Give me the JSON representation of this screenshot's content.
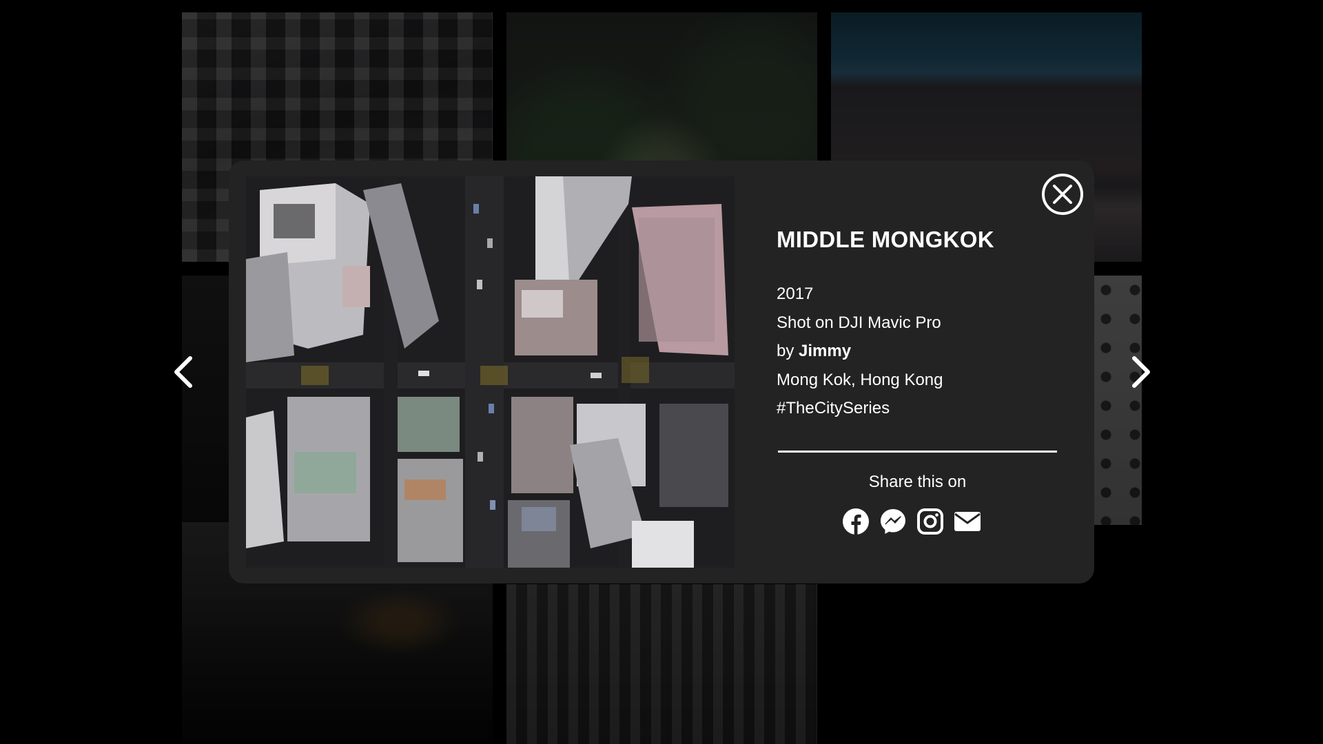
{
  "modal": {
    "title": "MIDDLE MONGKOK",
    "year": "2017",
    "camera": "Shot on DJI Mavic Pro",
    "by_prefix": "by",
    "author": "Jimmy",
    "location": "Mong Kok, Hong Kong",
    "hashtag": "#TheCitySeries",
    "share_label": "Share this on",
    "share_icons": [
      "facebook-icon",
      "messenger-icon",
      "instagram-icon",
      "email-icon"
    ],
    "close_icon": "close-circle-icon",
    "photo_alt": "aerial city photo"
  },
  "navigation": {
    "prev_icon": "chevron-left-icon",
    "next_icon": "chevron-right-icon"
  },
  "colors": {
    "backdrop": "#000000",
    "modal_background": "#232323",
    "text": "#ffffff"
  }
}
